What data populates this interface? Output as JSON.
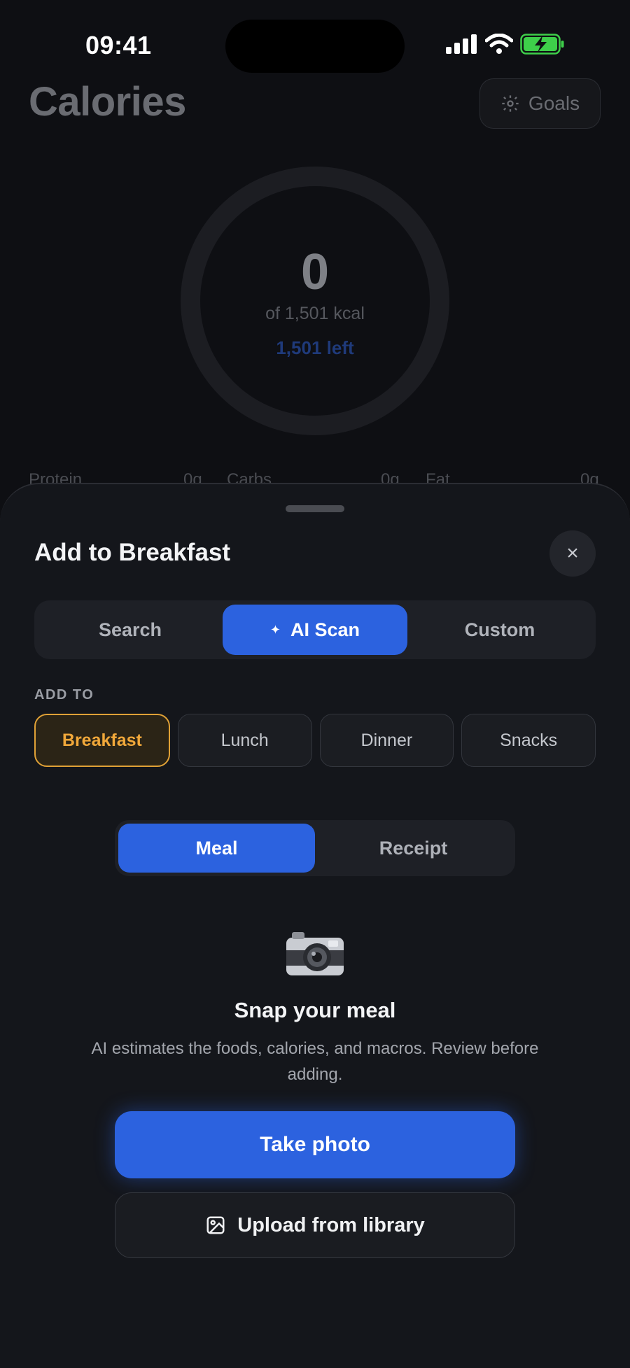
{
  "status_bar": {
    "time": "09:41",
    "icons": [
      "cellular-signal-icon",
      "wifi-icon",
      "battery-charging-icon"
    ]
  },
  "background": {
    "title": "Calories",
    "goals_label": "Goals",
    "ring": {
      "consumed": "0",
      "of_label": "of 1,501 kcal",
      "left_label": "1,501 left",
      "progress": 0
    },
    "macros": [
      {
        "name": "Protein",
        "value": "0g"
      },
      {
        "name": "Carbs",
        "value": "0g"
      },
      {
        "name": "Fat",
        "value": "0g"
      }
    ]
  },
  "sheet": {
    "title": "Add to Breakfast",
    "tabs": [
      {
        "label": "Search",
        "active": false
      },
      {
        "label": "AI Scan",
        "active": true
      },
      {
        "label": "Custom",
        "active": false
      }
    ],
    "add_to_label": "ADD TO",
    "meals": [
      {
        "label": "Breakfast",
        "active": true
      },
      {
        "label": "Lunch",
        "active": false
      },
      {
        "label": "Dinner",
        "active": false
      },
      {
        "label": "Snacks",
        "active": false
      }
    ],
    "modes": [
      {
        "label": "Meal",
        "active": true
      },
      {
        "label": "Receipt",
        "active": false
      }
    ],
    "scan": {
      "icon": "camera-icon",
      "title": "Snap your meal",
      "description": "AI estimates the foods, calories, and macros. Review before adding."
    },
    "take_photo_label": "Take photo",
    "upload_label": "Upload from library"
  },
  "colors": {
    "accent": "#2c62df",
    "meal_active": "#f1a83a",
    "sheet_bg": "#14161b"
  }
}
